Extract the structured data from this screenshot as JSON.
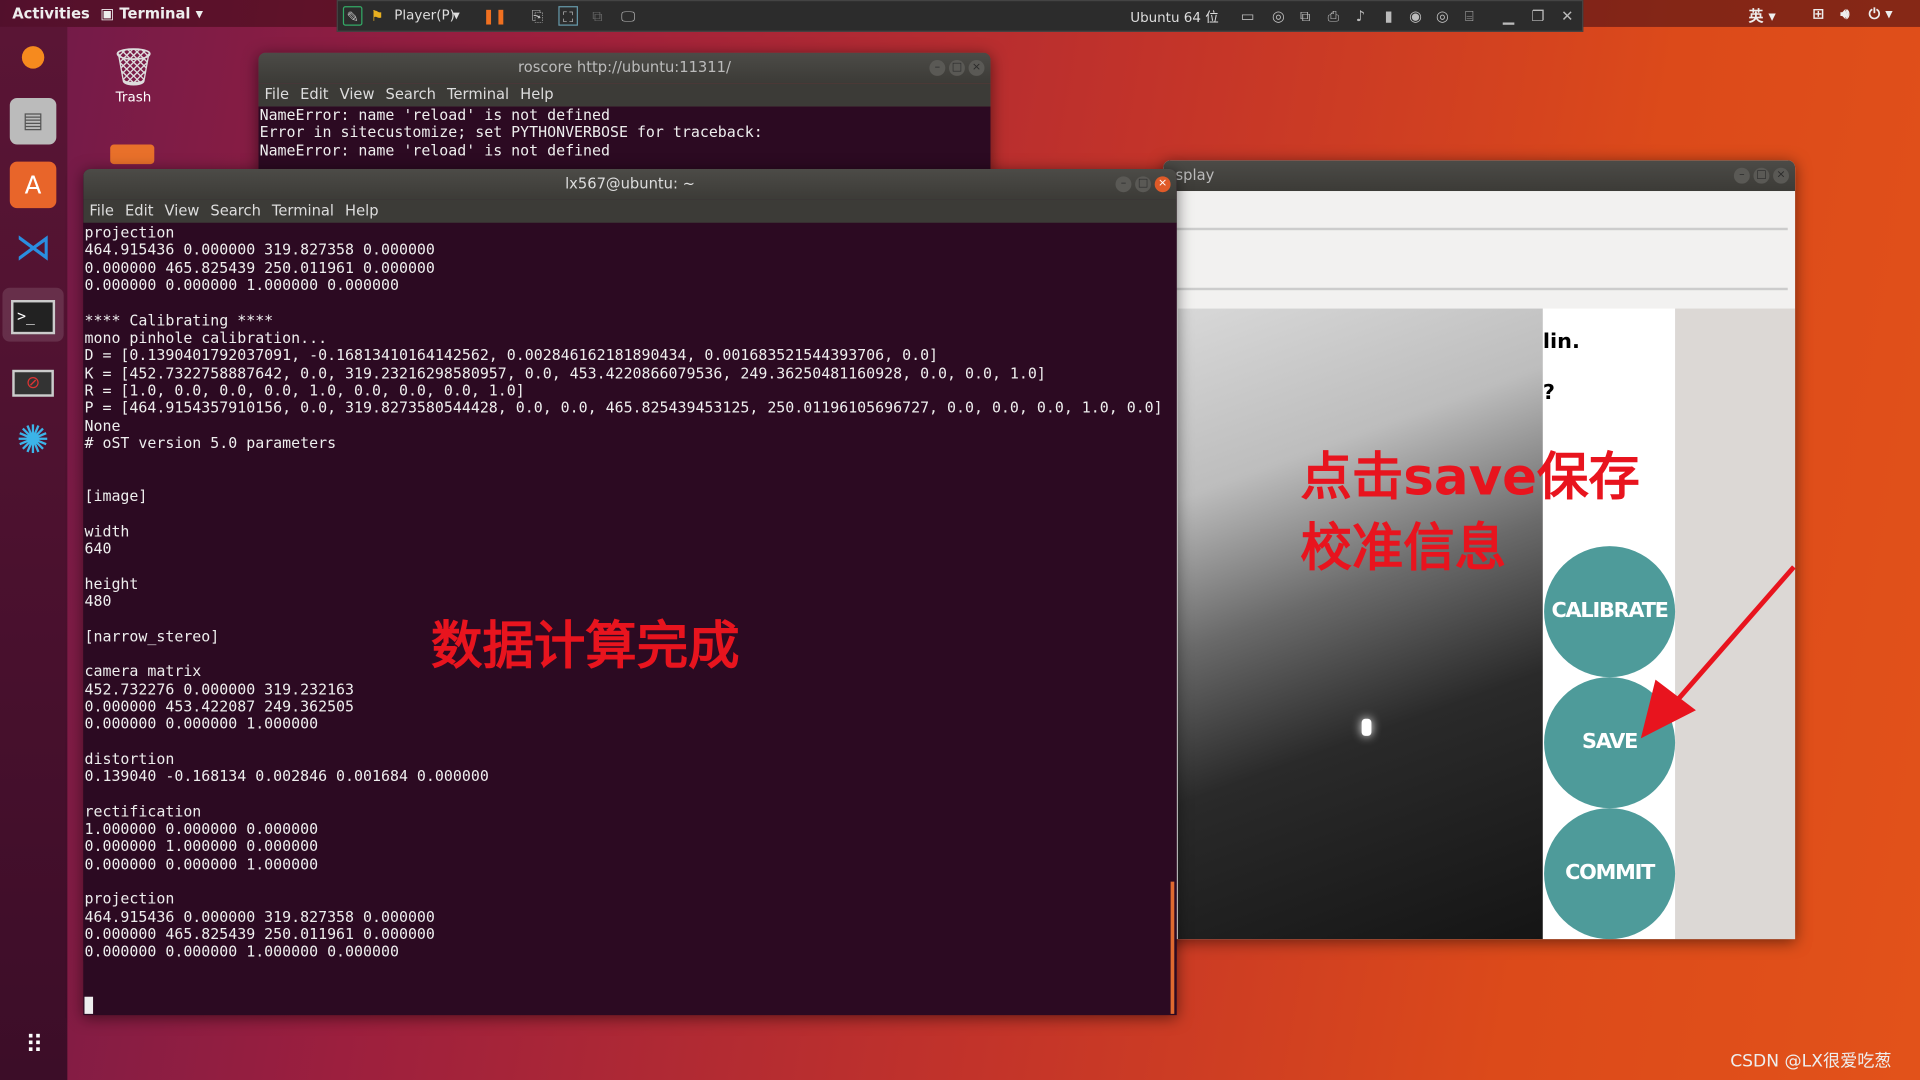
{
  "topbar": {
    "activities": "Activities",
    "app": "Terminal",
    "input_method": "英"
  },
  "vmware": {
    "player": "Player(P)",
    "vm_name": "Ubuntu 64 位"
  },
  "desktop": {
    "trash": "Trash"
  },
  "dock": {
    "items": [
      "firefox-icon",
      "files-icon",
      "software-icon",
      "vscode-icon",
      "terminal-icon",
      "blocked-app-icon",
      "splash-app-icon"
    ]
  },
  "roscore": {
    "title": "roscore http://ubuntu:11311/",
    "menu": [
      "File",
      "Edit",
      "View",
      "Search",
      "Terminal",
      "Help"
    ],
    "lines": [
      "NameError: name 'reload' is not defined",
      "Error in sitecustomize; set PYTHONVERBOSE for traceback:",
      "NameError: name 'reload' is not defined"
    ]
  },
  "terminal": {
    "title": "lx567@ubuntu: ~",
    "menu": [
      "File",
      "Edit",
      "View",
      "Search",
      "Terminal",
      "Help"
    ],
    "lines": [
      "projection",
      "464.915436 0.000000 319.827358 0.000000",
      "0.000000 465.825439 250.011961 0.000000",
      "0.000000 0.000000 1.000000 0.000000",
      "",
      "**** Calibrating ****",
      "mono pinhole calibration...",
      "D = [0.1390401792037091, -0.16813410164142562, 0.002846162181890434, 0.001683521544393706, 0.0]",
      "K = [452.7322758887642, 0.0, 319.23216298580957, 0.0, 453.4220866079536, 249.36250481160928, 0.0, 0.0, 1.0]",
      "R = [1.0, 0.0, 0.0, 0.0, 1.0, 0.0, 0.0, 0.0, 1.0]",
      "P = [464.9154357910156, 0.0, 319.8273580544428, 0.0, 0.0, 465.825439453125, 250.01196105696727, 0.0, 0.0, 0.0, 1.0, 0.0]",
      "None",
      "# oST version 5.0 parameters",
      "",
      "",
      "[image]",
      "",
      "width",
      "640",
      "",
      "height",
      "480",
      "",
      "[narrow_stereo]",
      "",
      "camera matrix",
      "452.732276 0.000000 319.232163",
      "0.000000 453.422087 249.362505",
      "0.000000 0.000000 1.000000",
      "",
      "distortion",
      "0.139040 -0.168134 0.002846 0.001684 0.000000",
      "",
      "rectification",
      "1.000000 0.000000 0.000000",
      "0.000000 1.000000 0.000000",
      "0.000000 0.000000 1.000000",
      "",
      "projection",
      "464.915436 0.000000 319.827358 0.000000",
      "0.000000 465.825439 250.011961 0.000000",
      "0.000000 0.000000 1.000000 0.000000"
    ]
  },
  "display": {
    "title_partial": "splay",
    "side_text": [
      "lin.",
      "?"
    ],
    "buttons": {
      "calibrate": "CALIBRATE",
      "save": "SAVE",
      "commit": "COMMIT"
    },
    "button_color": "#4e9b9a"
  },
  "annotations": {
    "done": "数据计算完成",
    "save_line1": "点击save保存",
    "save_line2": "校准信息",
    "color": "#e8141e"
  },
  "watermark": "CSDN @LX很爱吃葱"
}
